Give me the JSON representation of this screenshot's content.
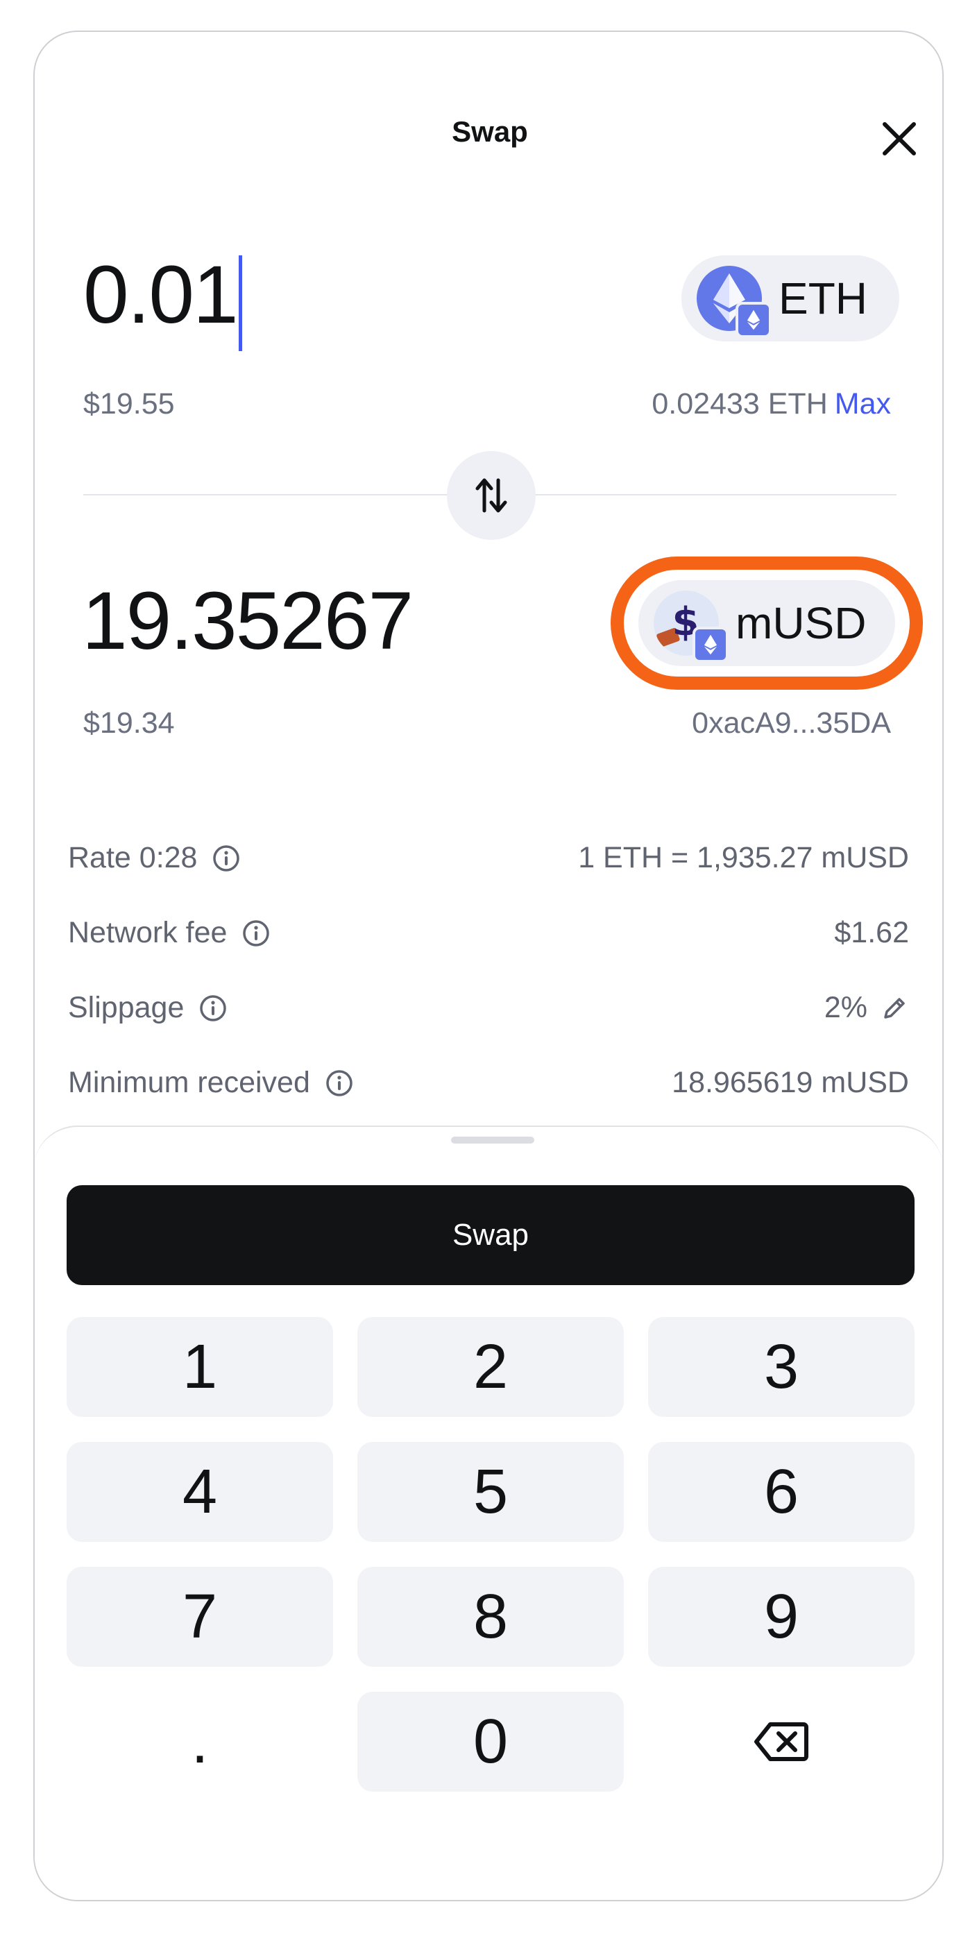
{
  "header": {
    "title": "Swap"
  },
  "from": {
    "amount": "0.01",
    "usd_value": "$19.55",
    "balance": "0.02433 ETH",
    "max_label": "Max",
    "token": "ETH"
  },
  "to": {
    "amount": "19.35267",
    "usd_value": "$19.34",
    "token": "mUSD",
    "address": "0xacA9...35DA"
  },
  "details": {
    "rate_label": "Rate 0:28",
    "rate_value": "1 ETH = 1,935.27 mUSD",
    "fee_label": "Network fee",
    "fee_value": "$1.62",
    "slippage_label": "Slippage",
    "slippage_value": "2%",
    "min_label": "Minimum received",
    "min_value": "18.965619 mUSD"
  },
  "action": {
    "swap_label": "Swap"
  },
  "keypad": {
    "k1": "1",
    "k2": "2",
    "k3": "3",
    "k4": "4",
    "k5": "5",
    "k6": "6",
    "k7": "7",
    "k8": "8",
    "k9": "9",
    "dot": ".",
    "k0": "0"
  },
  "icons": {
    "close": "close-icon",
    "flip": "swap-arrows-icon",
    "eth": "ethereum-icon",
    "musd": "dollar-coin-icon",
    "info": "info-icon",
    "edit": "pencil-icon",
    "backspace": "backspace-icon"
  },
  "colors": {
    "accent": "#4459f0",
    "highlight": "#f46316",
    "button": "#121314"
  }
}
